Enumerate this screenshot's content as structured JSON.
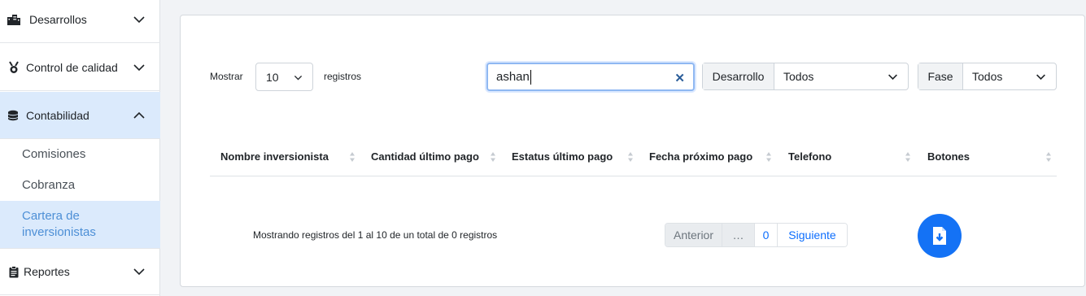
{
  "sidebar": {
    "items": [
      {
        "label": "Desarrollos",
        "icon": "buildings-icon"
      },
      {
        "label": "Control de calidad",
        "icon": "medal-icon"
      },
      {
        "label": "Contabilidad",
        "icon": "coins-icon"
      },
      {
        "label": "Reportes",
        "icon": "clipboard-icon"
      }
    ],
    "subitems": [
      "Comisiones",
      "Cobranza",
      "Cartera de inversionistas"
    ]
  },
  "controls": {
    "show_label": "Mostrar",
    "page_size": "10",
    "records_label": "registros",
    "search_value": "ashan",
    "desarrollo_label": "Desarrollo",
    "desarrollo_value": "Todos",
    "fase_label": "Fase",
    "fase_value": "Todos"
  },
  "table": {
    "columns": [
      "Nombre inversionista",
      "Cantidad último pago",
      "Estatus último pago",
      "Fecha próximo pago",
      "Telefono",
      "Botones"
    ],
    "rows": []
  },
  "footer": {
    "info": "Mostrando registros del 1 al 10 de un total de 0 registros",
    "prev": "Anterior",
    "dots": "…",
    "page": "0",
    "next": "Siguiente"
  },
  "colors": {
    "accent": "#1472f5",
    "active_bg": "#dbeafc",
    "active_text": "#4d8fd6"
  }
}
